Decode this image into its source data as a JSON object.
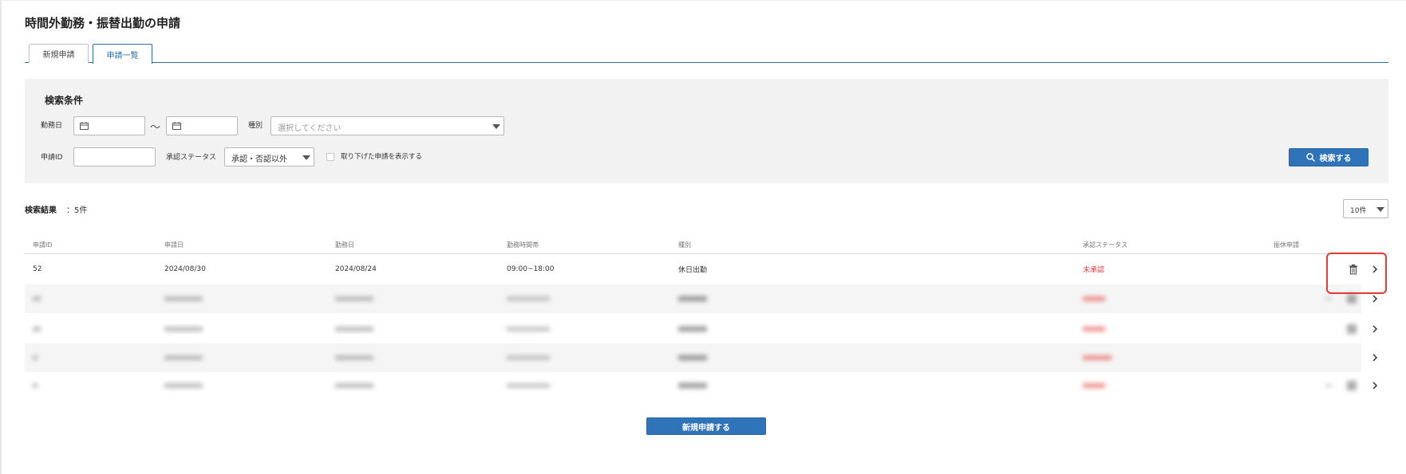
{
  "page": {
    "title": "時間外勤務・振替出勤の申請"
  },
  "tabs": [
    {
      "label": "新規申請"
    },
    {
      "label": "申請一覧"
    }
  ],
  "search": {
    "title": "検索条件",
    "work_date_label": "勤務日",
    "tilde": "～",
    "type_label": "種別",
    "type_placeholder": "選択してください",
    "request_id_label": "申請ID",
    "status_label": "承認ステータス",
    "status_value": "承認・否認以外",
    "withdrawn_label": "取り下げた申請を表示する",
    "search_button": "検索する"
  },
  "results": {
    "label": "検索結果",
    "count": "：5件",
    "page_size": "10件"
  },
  "table": {
    "headers": [
      "申請ID",
      "申請日",
      "勤務日",
      "勤務時間帯",
      "種別",
      "承認ステータス",
      "振休申請"
    ],
    "rows": [
      {
        "id": "52",
        "applied": "2024/08/30",
        "work_date": "2024/08/24",
        "time": "09:00~18:00",
        "type": "休日出勤",
        "status": "未承認",
        "leave": ""
      }
    ]
  },
  "footer": {
    "new_button": "新規申請する"
  },
  "colors": {
    "accent": "#2f74b8",
    "status_red": "#e53935",
    "highlight": "#e53935"
  }
}
